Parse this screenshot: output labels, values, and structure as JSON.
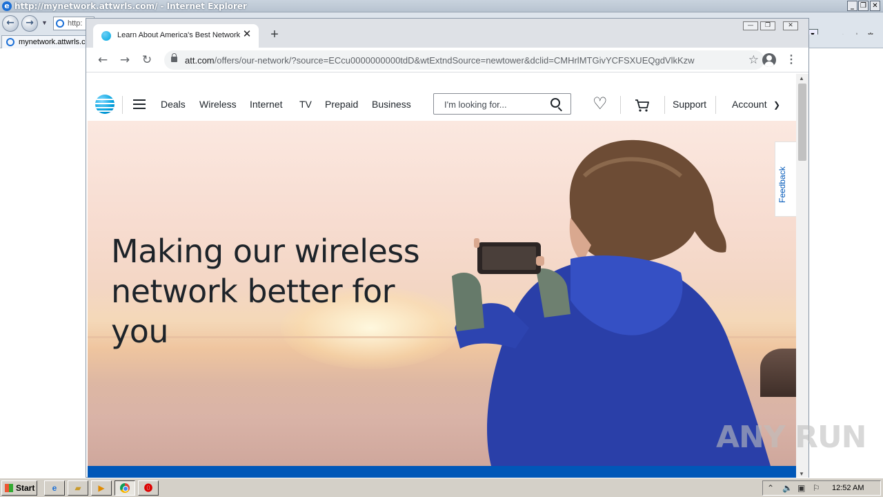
{
  "ie": {
    "title": "http://mynetwork.attwrls.com/ - Internet Explorer",
    "address_text": "http:",
    "tab_label": "mynetwork.attwrls.c"
  },
  "chrome": {
    "tab_title": "Learn About America's Best Network",
    "url_host": "att.com",
    "url_path": "/offers/our-network/?source=ECcu0000000000tdD&wtExtndSource=newtower&dclid=CMHrlMTGivYCFSXUEQgdVlkKzw"
  },
  "header": {
    "nav": [
      "Deals",
      "Wireless",
      "Internet",
      "TV",
      "Prepaid",
      "Business"
    ],
    "search_placeholder": "I'm looking for...",
    "support": "Support",
    "account": "Account"
  },
  "hero": {
    "title": "Making our wireless network better for you"
  },
  "feedback_label": "Feedback",
  "watermark": "ANY RUN",
  "taskbar": {
    "start_label": "Start",
    "clock": "12:52 AM"
  },
  "colors": {
    "att_blue": "#009fdb",
    "att_cobalt": "#0057b8",
    "text_dark": "#1d2329"
  },
  "icons": {
    "search": "search-icon",
    "favorites": "heart-icon",
    "cart": "cart-icon",
    "profile": "profile-icon"
  }
}
